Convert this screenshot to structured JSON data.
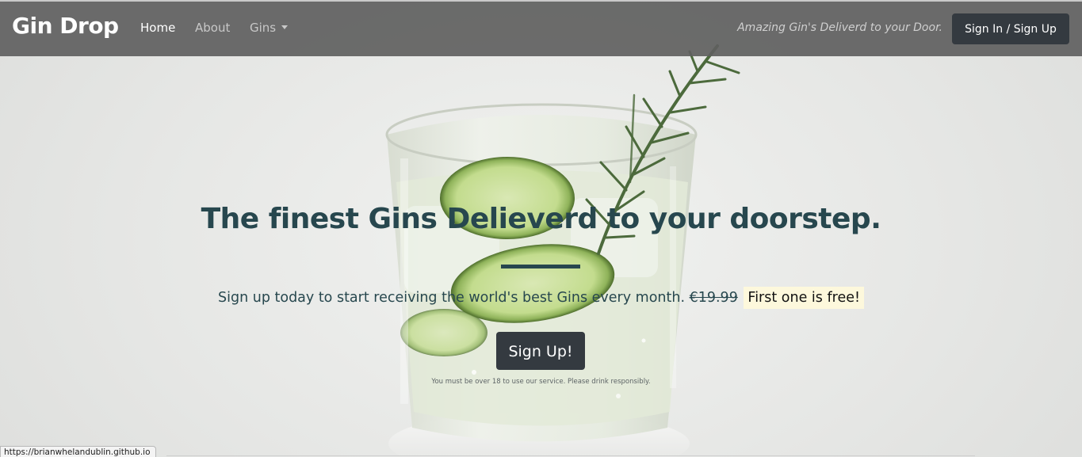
{
  "navbar": {
    "brand": "Gin Drop",
    "links": [
      {
        "label": "Home",
        "active": true
      },
      {
        "label": "About",
        "active": false
      },
      {
        "label": "Gins",
        "active": false,
        "dropdown": true
      }
    ],
    "tagline": "Amazing Gin's Deliverd to your Door.",
    "signin_label": "Sign In / Sign Up"
  },
  "hero": {
    "title": "The finest Gins Delieverd to your doorstep.",
    "lead": "Sign up today to start receiving the world's best Gins every month.",
    "old_price": "€19.99",
    "free_text": "First one is free!",
    "signup_label": "Sign Up!",
    "disclaimer": "You must be over 18 to use our service. Please drink responsibly."
  },
  "status_bar": {
    "url": "https://brianwhelandublin.github.io"
  },
  "colors": {
    "navbar_bg": "#5f605f",
    "heading": "#27474e",
    "button_dark": "#343a40",
    "highlight": "#fdf8dc"
  },
  "icons": {
    "dropdown_caret": "chevron-down-icon"
  }
}
